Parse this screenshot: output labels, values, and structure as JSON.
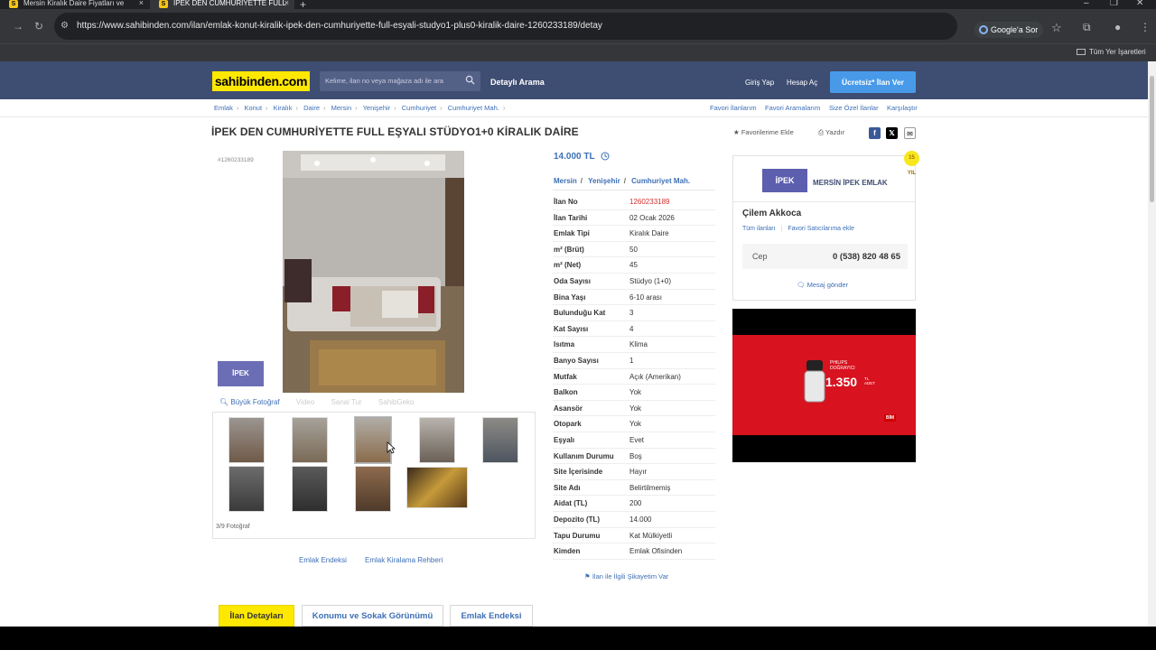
{
  "browser": {
    "tabs": [
      {
        "title": "Mersin Kiralık Daire Fiyatları ve",
        "active": false
      },
      {
        "title": "İPEK DEN CUMHURİYETTE FULL",
        "active": true
      }
    ],
    "url": "https://www.sahibinden.com/ilan/emlak-konut-kiralik-ipek-den-cumhuriyette-full-esyali-studyo1-plus0-kiralik-daire-1260233189/detay",
    "google_ask": "Google'a Sor",
    "all_bookmarks": "Tüm Yer İşaretleri"
  },
  "header": {
    "logo": "sahibinden.com",
    "search_placeholder": "Kelime, ilan no veya mağaza adı ile ara",
    "detailed_search": "Detaylı Arama",
    "login": "Giriş Yap",
    "register": "Hesap Aç",
    "post_ad": "Ücretsiz* İlan Ver"
  },
  "breadcrumb": [
    "Emlak",
    "Konut",
    "Kiralık",
    "Daire",
    "Mersin",
    "Yenişehir",
    "Cumhuriyet",
    "Cumhuriyet Mah."
  ],
  "top_links": [
    "Favori İlanlarım",
    "Favori Aramalarım",
    "Size Özel İlanlar",
    "Karşılaştır"
  ],
  "listing": {
    "title": "İPEK DEN CUMHURİYETTE FULL EŞYALI STÜDYO1+0 KİRALIK DAİRE",
    "add_favorite": "Favorilerime Ekle",
    "print": "Yazdır",
    "id_small": "#1260233189",
    "price": "14.000 TL",
    "location": [
      "Mersin",
      "Yenişehir",
      "Cumhuriyet Mah."
    ],
    "agency_thumb": "İPEK",
    "photo_tools": {
      "big_photo": "Büyük Fotoğraf",
      "video": "Video",
      "virtual_tour": "Sanal Tur",
      "sahibinden_360": "SahibGeko"
    },
    "photo_count": "3/9 Fotoğraf",
    "bottom_links": [
      "Emlak Endeksi",
      "Emlak Kiralama Rehberi"
    ],
    "complaint": "İlan ile İlgili Şikayetim Var"
  },
  "details": [
    {
      "k": "İlan No",
      "v": "1260233189",
      "red": true
    },
    {
      "k": "İlan Tarihi",
      "v": "02 Ocak 2026"
    },
    {
      "k": "Emlak Tipi",
      "v": "Kiralık Daire"
    },
    {
      "k": "m² (Brüt)",
      "v": "50"
    },
    {
      "k": "m² (Net)",
      "v": "45"
    },
    {
      "k": "Oda Sayısı",
      "v": "Stüdyo (1+0)"
    },
    {
      "k": "Bina Yaşı",
      "v": "6-10 arası"
    },
    {
      "k": "Bulunduğu Kat",
      "v": "3"
    },
    {
      "k": "Kat Sayısı",
      "v": "4"
    },
    {
      "k": "Isıtma",
      "v": "Klima"
    },
    {
      "k": "Banyo Sayısı",
      "v": "1"
    },
    {
      "k": "Mutfak",
      "v": "Açık (Amerikan)"
    },
    {
      "k": "Balkon",
      "v": "Yok"
    },
    {
      "k": "Asansör",
      "v": "Yok"
    },
    {
      "k": "Otopark",
      "v": "Yok"
    },
    {
      "k": "Eşyalı",
      "v": "Evet"
    },
    {
      "k": "Kullanım Durumu",
      "v": "Boş"
    },
    {
      "k": "Site İçerisinde",
      "v": "Hayır"
    },
    {
      "k": "Site Adı",
      "v": "Belirtilmemiş"
    },
    {
      "k": "Aidat (TL)",
      "v": "200"
    },
    {
      "k": "Depozito (TL)",
      "v": "14.000"
    },
    {
      "k": "Tapu Durumu",
      "v": "Kat Mülkiyetli"
    },
    {
      "k": "Kimden",
      "v": "Emlak Ofisinden"
    }
  ],
  "seller": {
    "agency_logo": "İPEK",
    "agency_name": "MERSİN İPEK EMLAK",
    "person": "Çilem Akkoca",
    "all_ads": "Tüm ilanları",
    "add_fav_seller": "Favori Satıcılarıma ekle",
    "phone_label": "Cep",
    "phone": "0 (538) 820 48 65",
    "message": "Mesaj gönder",
    "badge": "15 YIL"
  },
  "ad": {
    "brand": "PHILIPS",
    "product": "DOĞRAYICI",
    "price": "1.350",
    "unit": "TL ADET",
    "store": "BİM"
  },
  "bottom_tabs": [
    "İlan Detayları",
    "Konumu ve Sokak Görünümü",
    "Emlak Endeksi"
  ],
  "colors": {
    "brand_yellow": "#ffe800",
    "header_navy": "#3e4d72",
    "link_blue": "#3d6fb6",
    "cta_blue": "#489ae9"
  }
}
